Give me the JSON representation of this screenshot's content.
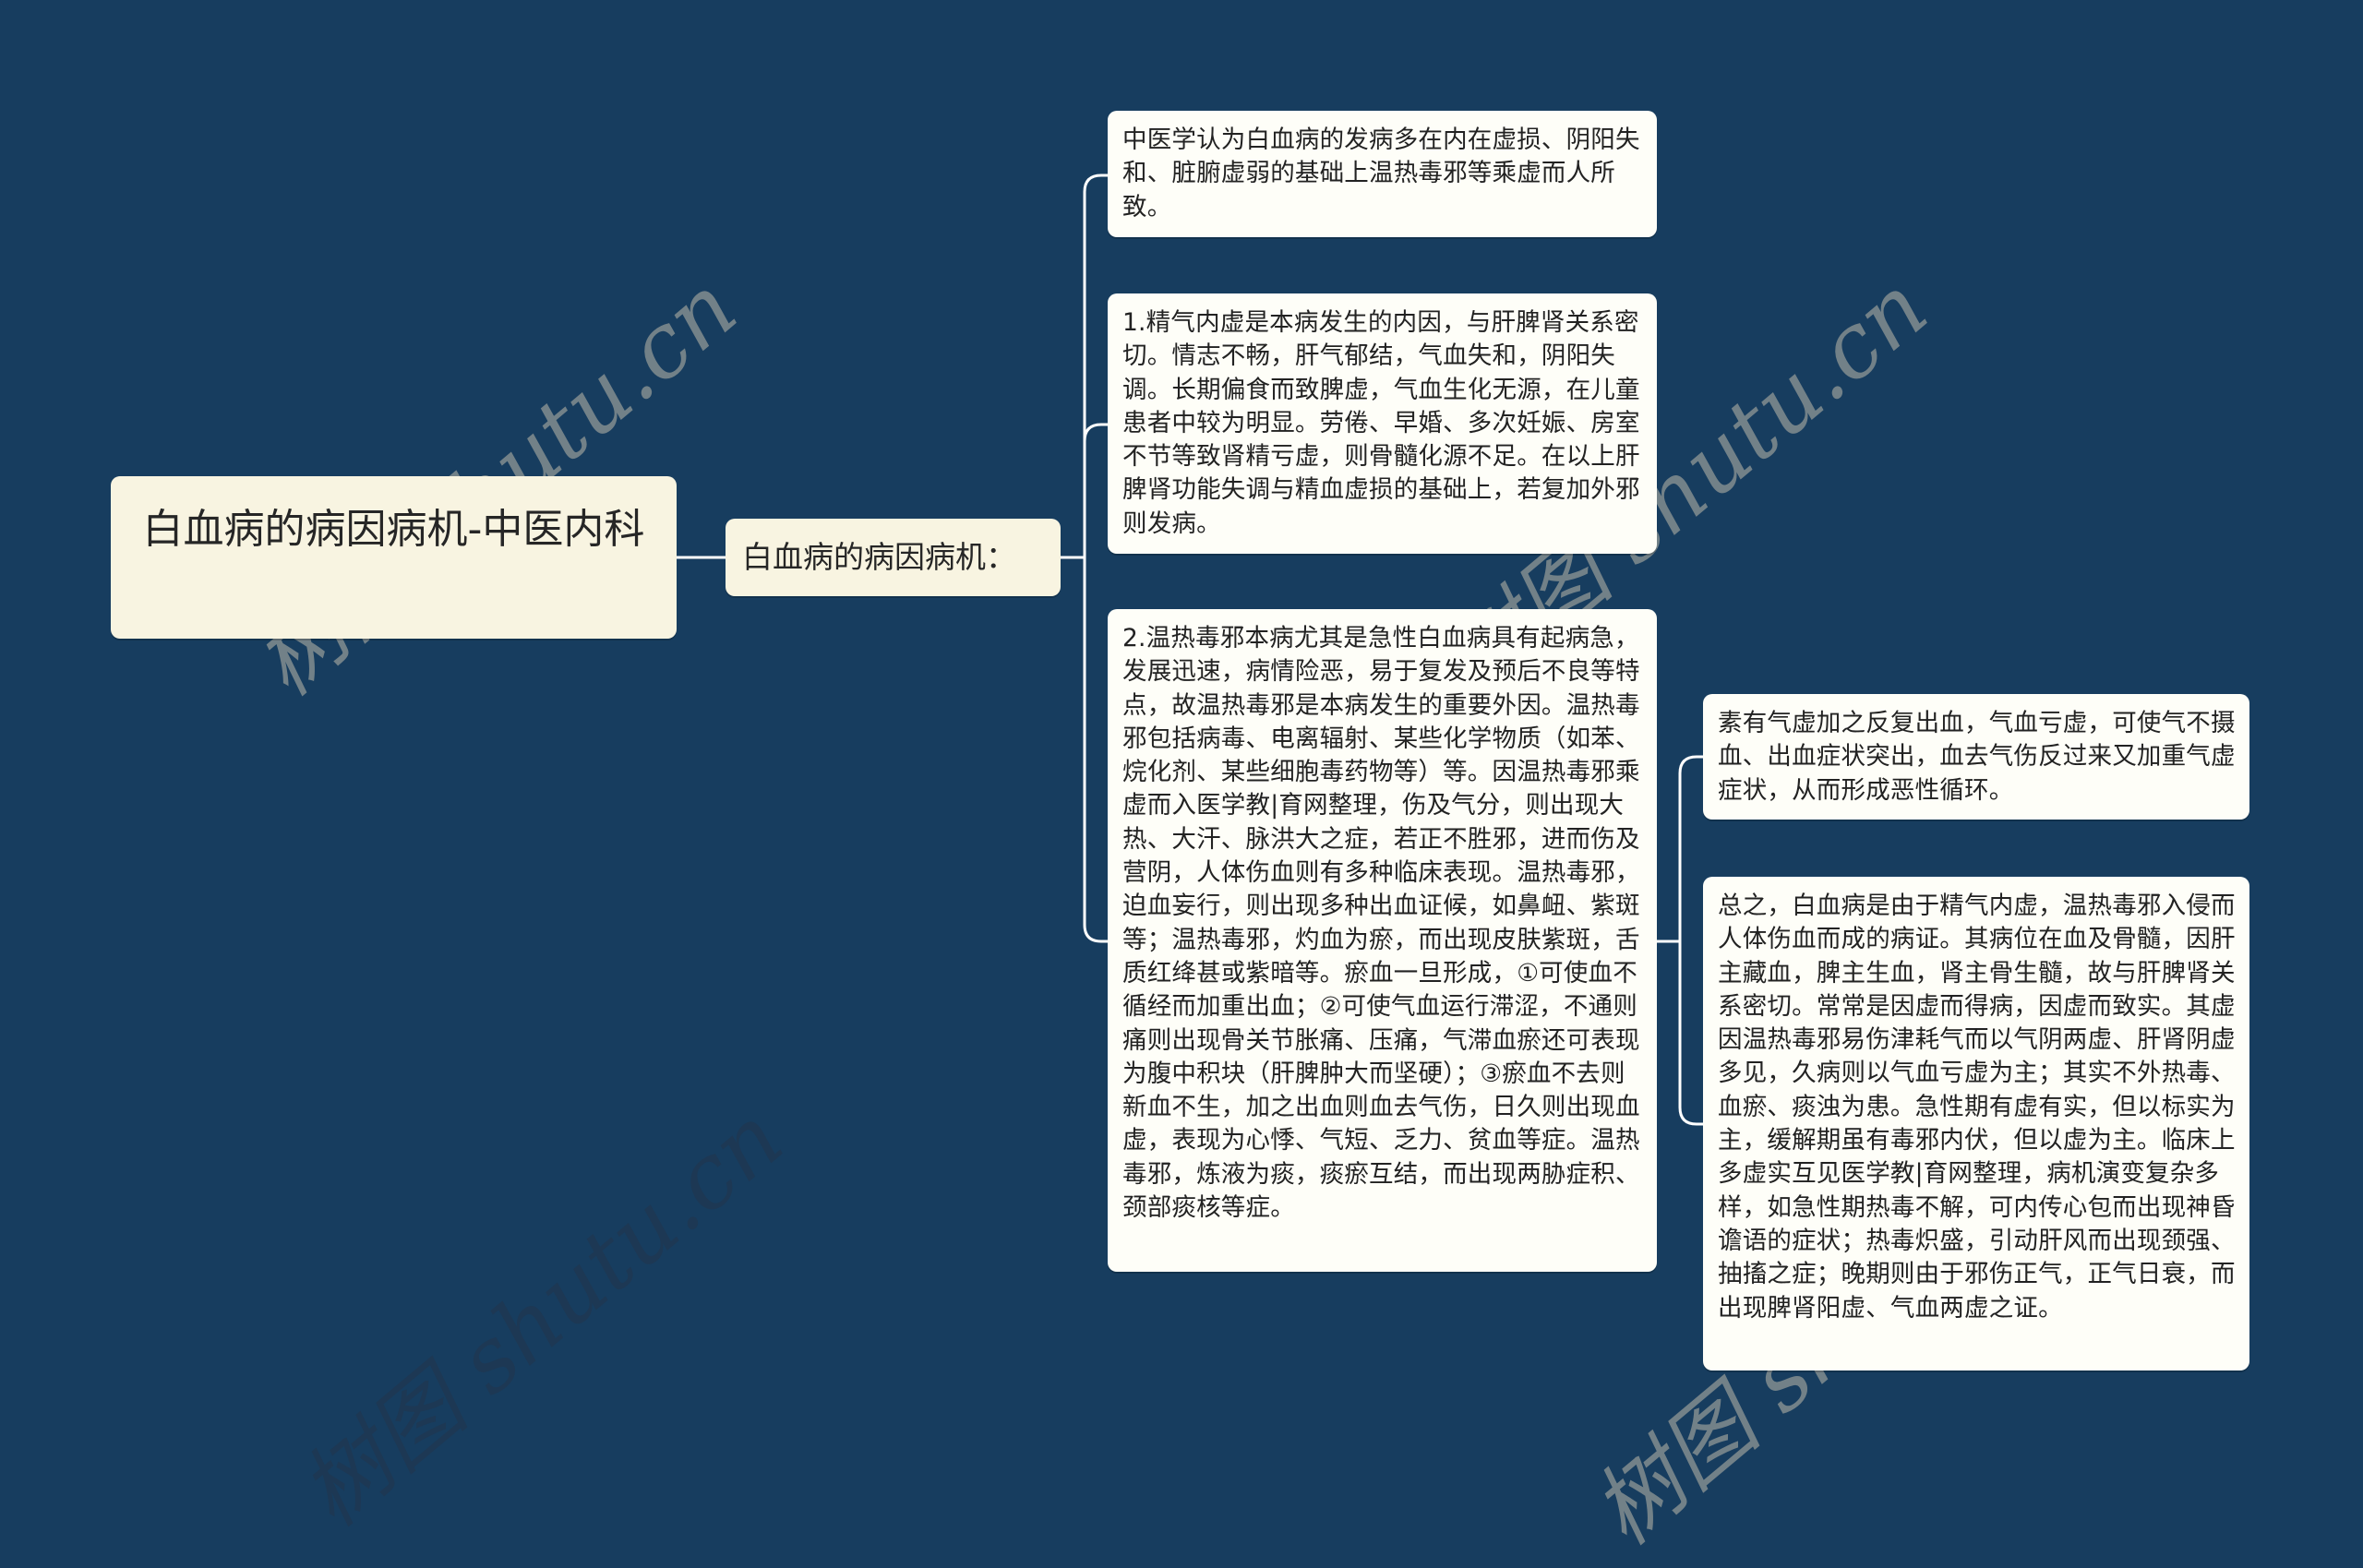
{
  "mindmap": {
    "root": {
      "label": "白血病的病因病机-中医内科"
    },
    "branch": {
      "label": "白血病的病因病机："
    },
    "leaves": [
      {
        "text": "中医学认为白血病的发病多在内在虚损、阴阳失和、脏腑虚弱的基础上温热毒邪等乘虚而人所致。"
      },
      {
        "text": "1.精气内虚是本病发生的内因，与肝脾肾关系密切。情志不畅，肝气郁结，气血失和，阴阳失调。长期偏食而致脾虚，气血生化无源，在儿童患者中较为明显。劳倦、早婚、多次妊娠、房室不节等致肾精亏虚，则骨髓化源不足。在以上肝脾肾功能失调与精血虚损的基础上，若复加外邪则发病。"
      },
      {
        "text": "2.温热毒邪本病尤其是急性白血病具有起病急，发展迅速，病情险恶，易于复发及预后不良等特点，故温热毒邪是本病发生的重要外因。温热毒邪包括病毒、电离辐射、某些化学物质（如苯、烷化剂、某些细胞毒药物等）等。因温热毒邪乘虚而入医学教|育网整理，伤及气分，则出现大热、大汗、脉洪大之症，若正不胜邪，进而伤及营阴，人体伤血则有多种临床表现。温热毒邪，迫血妄行，则出现多种出血证候，如鼻衄、紫斑等；温热毒邪，灼血为瘀，而出现皮肤紫斑，舌质红绛甚或紫暗等。瘀血一旦形成，①可使血不循经而加重出血；②可使气血运行滞涩，不通则痛则出现骨关节胀痛、压痛，气滞血瘀还可表现为腹中积块（肝脾肿大而坚硬）；③瘀血不去则新血不生，加之出血则血去气伤，日久则出现血虚，表现为心悸、气短、乏力、贫血等症。温热毒邪，炼液为痰，痰瘀互结，而出现两胁症积、颈部痰核等症。",
        "children": [
          {
            "text": "素有气虚加之反复出血，气血亏虚，可使气不摄血、出血症状突出，血去气伤反过来又加重气虚症状，从而形成恶性循环。"
          },
          {
            "text": "总之，白血病是由于精气内虚，温热毒邪入侵而人体伤血而成的病证。其病位在血及骨髓，因肝主藏血，脾主生血，肾主骨生髓，故与肝脾肾关系密切。常常是因虚而得病，因虚而致实。其虚因温热毒邪易伤津耗气而以气阴两虚、肝肾阴虚多见，久病则以气血亏虚为主；其实不外热毒、血瘀、痰浊为患。急性期有虚有实，但以标实为主，缓解期虽有毒邪内伏，但以虚为主。临床上多虚实互见医学教|育网整理，病机演变复杂多样，如急性期热毒不解，可内传心包而出现神昏谵语的症状；热毒炽盛，引动肝风而出现颈强、抽搐之症；晚期则由于邪伤正气，正气日衰，而出现脾肾阳虚、气血两虚之证。"
          }
        ]
      }
    ]
  },
  "watermark": {
    "text": "树图 shutu.cn"
  },
  "colors": {
    "background": "#173d5f",
    "root_fill": "#f8f4e1",
    "leaf_fill": "#fefef8",
    "connector": "#ffffff",
    "text": "#262626"
  }
}
